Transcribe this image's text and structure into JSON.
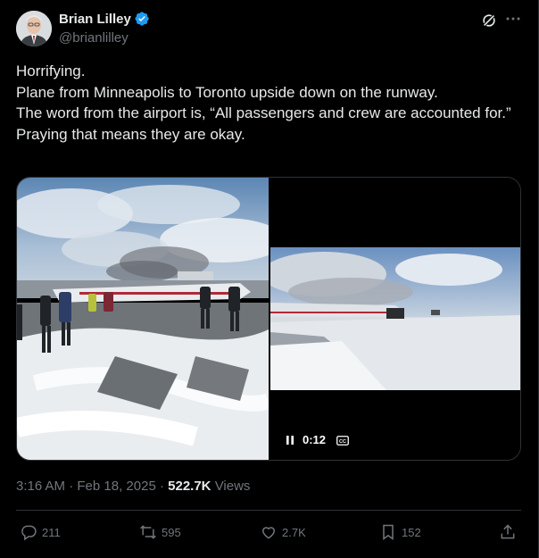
{
  "author": {
    "display_name": "Brian Lilley",
    "handle": "@brianlilley"
  },
  "tweet": {
    "lines": [
      "Horrifying.",
      "Plane from Minneapolis to Toronto upside down on the runway.",
      "The word from the airport is, “All passengers and crew are accounted for.”",
      "Praying that means they are okay."
    ]
  },
  "video": {
    "elapsed": "0:12"
  },
  "meta": {
    "time": "3:16 AM",
    "separator1": "·",
    "date": "Feb 18, 2025",
    "separator2": "·",
    "views_count": "522.7K",
    "views_label": "Views"
  },
  "actions": {
    "replies": "211",
    "reposts": "595",
    "likes": "2.7K",
    "bookmarks": "152"
  },
  "icons": {
    "verified": "verified-badge-icon",
    "grok": "grok-icon",
    "more": "more-icon",
    "reply": "reply-icon",
    "repost": "repost-icon",
    "like": "like-icon",
    "bookmark": "bookmark-icon",
    "share": "share-icon",
    "pause": "pause-icon",
    "captions": "captions-icon"
  },
  "colors": {
    "background": "#000000",
    "text": "#e7e9ea",
    "muted": "#71767b",
    "accent": "#1d9bf0",
    "border": "#2f3336"
  }
}
